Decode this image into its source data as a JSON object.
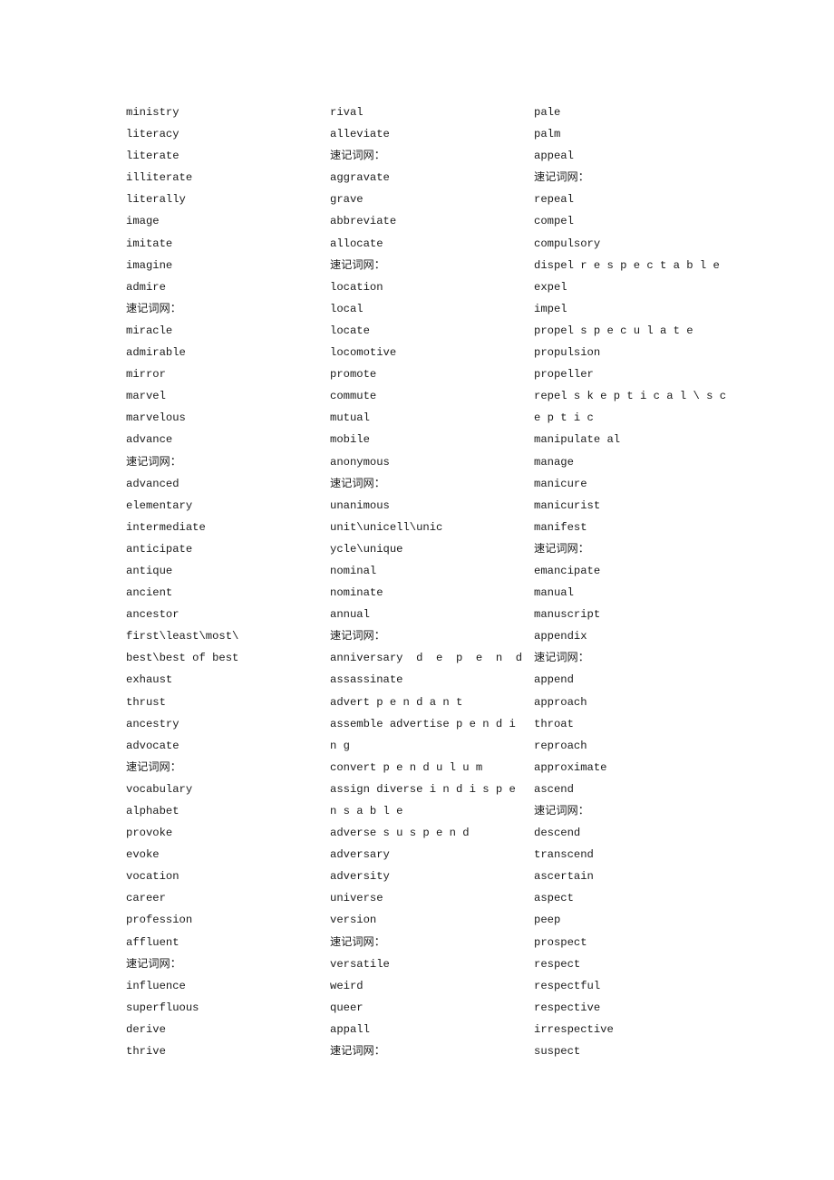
{
  "columns": [
    {
      "lines": [
        "ministry",
        "literacy",
        "literate",
        "illiterate",
        "literally",
        "image",
        "imitate",
        "imagine",
        "admire",
        "速记词网：",
        "miracle",
        "admirable",
        "mirror",
        "marvel",
        "marvelous",
        "advance",
        "速记词网：",
        "advanced",
        "elementary",
        "intermediate",
        "anticipate",
        "antique",
        "ancient",
        "ancestor",
        "first\\least\\most\\",
        "best\\best of best",
        "exhaust",
        "thrust",
        "ancestry",
        "advocate",
        "速记词网：",
        "vocabulary",
        "alphabet",
        "provoke",
        "evoke",
        "vocation",
        "career",
        "profession",
        "affluent",
        "速记词网：",
        "influence",
        "superfluous",
        "derive",
        "thrive"
      ]
    },
    {
      "lines": [
        "rival",
        "alleviate",
        "速记词网：",
        "aggravate",
        "grave",
        "abbreviate",
        "allocate",
        "速记词网：",
        "location",
        "local",
        "locate",
        "locomotive",
        "promote",
        "commute",
        "mutual",
        "mobile",
        "anonymous",
        "速记词网：",
        "unanimous",
        "unit\\unicell\\unic",
        "ycle\\unique",
        "nominal",
        "nominate",
        "annual",
        "速记词网：",
        "anniversary  d  e  p  e  n  d",
        "assassinate",
        "advert p e n d a n t",
        "assemble advertise p e n d i",
        "n g",
        "convert p e n d u l u m",
        "assign diverse i n d i s p e",
        "n s a b l e",
        "adverse s u s p e n d",
        "adversary",
        "adversity",
        "universe",
        "version",
        "速记词网：",
        "versatile",
        "weird",
        "queer",
        "appall",
        "速记词网："
      ]
    },
    {
      "lines": [
        "pale",
        "palm",
        "appeal",
        "速记词网：",
        "repeal",
        "compel",
        "compulsory",
        "dispel r e s p e c t a b l e",
        "expel",
        "impel",
        "propel s p e c u l a t e",
        "propulsion",
        "propeller",
        "repel s k e p t i c a l \\ s c",
        "e p t i c",
        "manipulate al",
        "manage",
        "manicure",
        "manicurist",
        "manifest",
        "速记词网：",
        "emancipate",
        "manual",
        "manuscript",
        "appendix",
        "速记词网：",
        "append",
        "approach",
        "throat",
        "reproach",
        "approximate",
        "ascend",
        "速记词网：",
        "descend",
        "transcend",
        "ascertain",
        "aspect",
        "peep",
        "prospect",
        "respect",
        "respectful",
        "respective",
        "irrespective",
        "suspect"
      ]
    }
  ]
}
